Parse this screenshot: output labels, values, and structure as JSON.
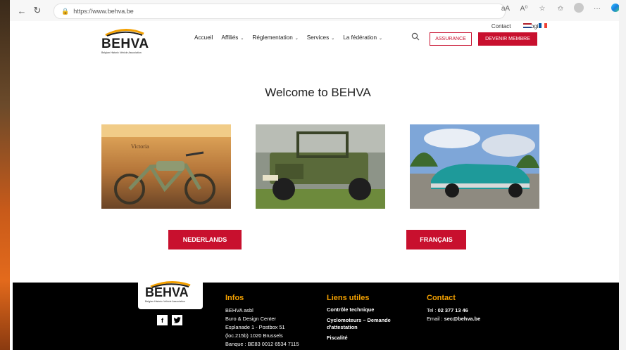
{
  "browser": {
    "url": "https://www.behva.be",
    "read_aloud": "aA",
    "immersive": "A⁰"
  },
  "topbar": {
    "contact": "Contact",
    "login": "Login"
  },
  "logo": {
    "word": "BEHVA",
    "tagline": "Belgian Historic Vehicle Association"
  },
  "nav": {
    "items": [
      {
        "label": "Accueil",
        "caret": ""
      },
      {
        "label": "Affiliés",
        "caret": "⌄"
      },
      {
        "label": "Réglementation",
        "caret": "⌄"
      },
      {
        "label": "Services",
        "caret": "⌄"
      },
      {
        "label": "La fédération",
        "caret": "⌄"
      }
    ],
    "assurance": "ASSURANCE",
    "member": "DEVENIR MEMBRE"
  },
  "main": {
    "welcome": "Welcome to BEHVA",
    "lang_nl": "NEDERLANDS",
    "lang_fr": "FRANÇAIS",
    "photo_sign": "Victoria"
  },
  "footer": {
    "logo_word": "BEHVA",
    "logo_tag": "Belgian Historic Vehicle Association",
    "facebook": "f",
    "twitter": "🐦",
    "infos": {
      "title": "Infos",
      "lines": [
        "BEHVA asbl",
        "Buro & Design Center",
        "Esplanade 1 - Postbox 51",
        "(loc.215b) 1020 Brussels",
        "Banque : BE83 0012 6534 7115"
      ]
    },
    "liens": {
      "title": "Liens utiles",
      "items": [
        "Contrôle technique",
        "Cyclomoteurs – Demande d'attestation",
        "Fiscalité"
      ]
    },
    "contact": {
      "title": "Contact",
      "tel_label": "Tel : ",
      "tel": "02 377 13 46",
      "email_label": "Email : ",
      "email": "sec@behva.be"
    }
  },
  "colors": {
    "brand_red": "#c8102e",
    "footer_title": "#f3a000"
  }
}
